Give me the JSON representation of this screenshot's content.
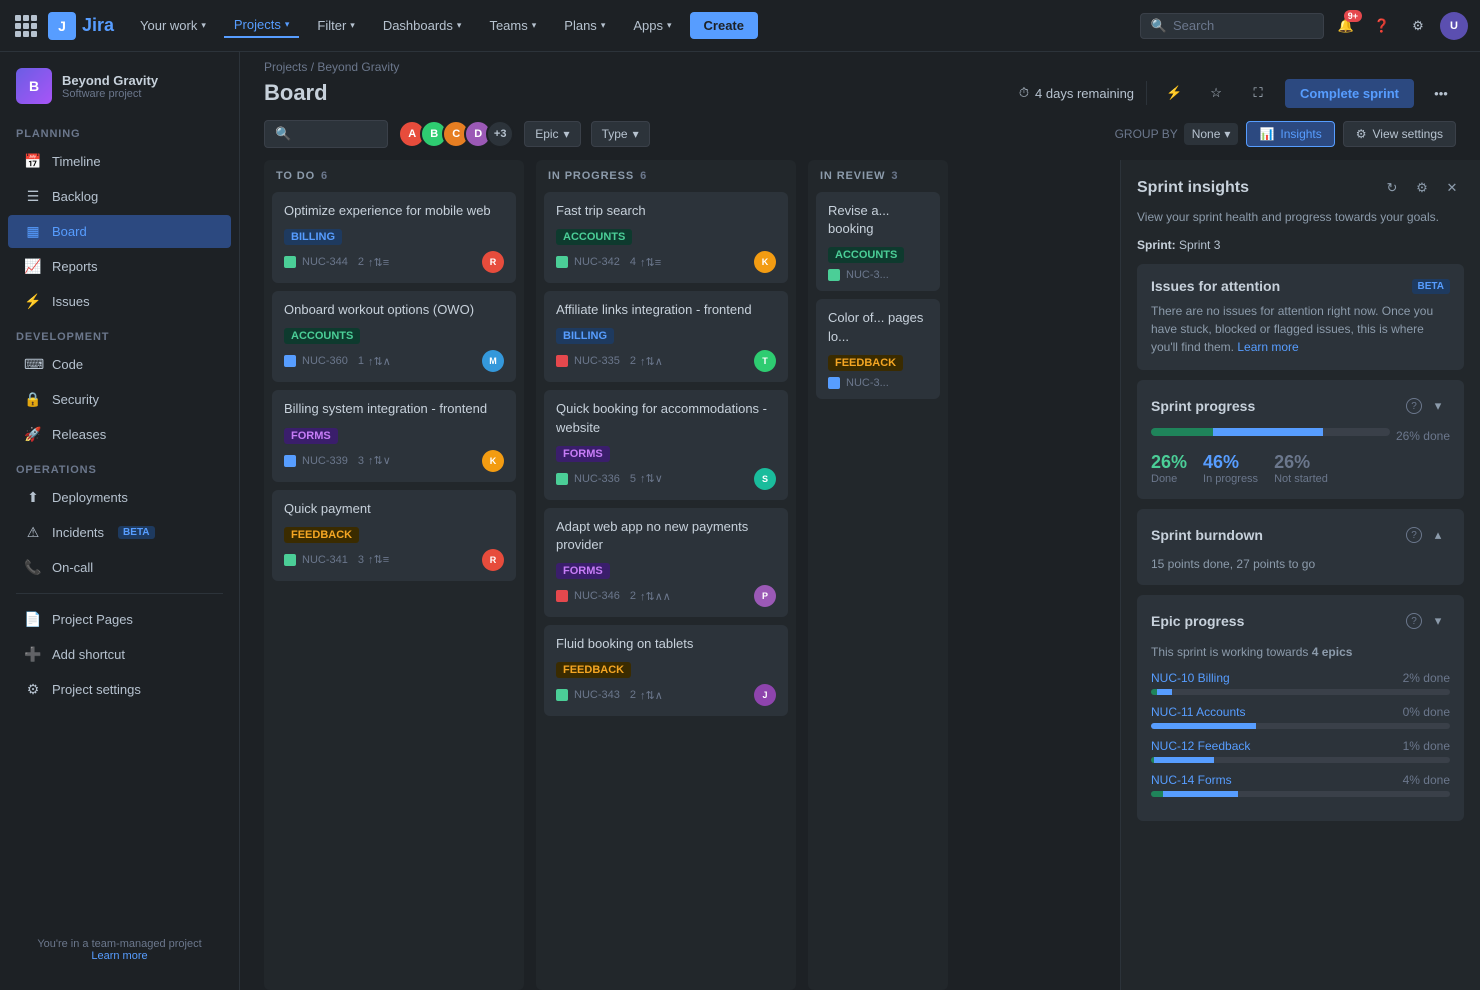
{
  "app": {
    "name": "Jira",
    "logo_text": "Jira"
  },
  "topnav": {
    "items": [
      {
        "id": "your-work",
        "label": "Your work",
        "chevron": true
      },
      {
        "id": "projects",
        "label": "Projects",
        "chevron": true,
        "active": true
      },
      {
        "id": "filter",
        "label": "Filter",
        "chevron": true
      },
      {
        "id": "dashboards",
        "label": "Dashboards",
        "chevron": true
      },
      {
        "id": "teams",
        "label": "Teams",
        "chevron": true
      },
      {
        "id": "plans",
        "label": "Plans",
        "chevron": true
      },
      {
        "id": "apps",
        "label": "Apps",
        "chevron": true
      }
    ],
    "create_label": "Create",
    "search_placeholder": "Search",
    "notif_count": "9+"
  },
  "sidebar": {
    "project_name": "Beyond Gravity",
    "project_type": "Software project",
    "project_icon_letter": "B",
    "sections": [
      {
        "label": "PLANNING",
        "items": [
          {
            "id": "timeline",
            "label": "Timeline",
            "icon": "📅"
          },
          {
            "id": "backlog",
            "label": "Backlog",
            "icon": "☰"
          },
          {
            "id": "board",
            "label": "Board",
            "icon": "▦",
            "active": true
          },
          {
            "id": "reports",
            "label": "Reports",
            "icon": "📈"
          },
          {
            "id": "issues",
            "label": "Issues",
            "icon": "⚡"
          }
        ]
      },
      {
        "label": "DEVELOPMENT",
        "items": [
          {
            "id": "code",
            "label": "Code",
            "icon": "⌨"
          },
          {
            "id": "security",
            "label": "Security",
            "icon": "🔒"
          },
          {
            "id": "releases",
            "label": "Releases",
            "icon": "🚀"
          }
        ]
      },
      {
        "label": "OPERATIONS",
        "items": [
          {
            "id": "deployments",
            "label": "Deployments",
            "icon": "⬆"
          },
          {
            "id": "incidents",
            "label": "Incidents",
            "icon": "⚠",
            "beta": true
          },
          {
            "id": "oncall",
            "label": "On-call",
            "icon": "📞"
          }
        ]
      }
    ],
    "footer_items": [
      {
        "id": "project-pages",
        "label": "Project Pages",
        "icon": "📄"
      },
      {
        "id": "add-shortcut",
        "label": "Add shortcut",
        "icon": "➕"
      },
      {
        "id": "project-settings",
        "label": "Project settings",
        "icon": "⚙"
      }
    ],
    "team_managed_text": "You're in a team-managed project",
    "learn_more": "Learn more"
  },
  "board": {
    "breadcrumb_project": "Projects",
    "breadcrumb_current": "Beyond Gravity",
    "title": "Board",
    "sprint_timer": "4 days remaining",
    "complete_sprint_label": "Complete sprint",
    "toolbar": {
      "epic_label": "Epic",
      "type_label": "Type",
      "group_by_label": "GROUP BY",
      "group_by_value": "None",
      "insights_label": "Insights",
      "view_settings_label": "View settings"
    },
    "avatars": [
      {
        "color": "#e74c3c",
        "letter": "A"
      },
      {
        "color": "#2ecc71",
        "letter": "B"
      },
      {
        "color": "#e67e22",
        "letter": "C"
      },
      {
        "color": "#9b59b6",
        "letter": "D"
      }
    ],
    "extra_avatars": "+3",
    "columns": [
      {
        "id": "todo",
        "label": "TO DO",
        "count": 6,
        "cards": [
          {
            "id": "card-1",
            "title": "Optimize experience for mobile web",
            "tag": "BILLING",
            "tag_type": "billing",
            "issue_id": "NUC-344",
            "issue_type": "story",
            "stats": "2",
            "priority": "medium",
            "avatar_color": "#e74c3c",
            "avatar_letter": "R"
          },
          {
            "id": "card-2",
            "title": "Onboard workout options (OWO)",
            "tag": "ACCOUNTS",
            "tag_type": "accounts",
            "issue_id": "NUC-360",
            "issue_type": "task",
            "stats": "1",
            "priority": "high",
            "avatar_color": "#3498db",
            "avatar_letter": "M"
          },
          {
            "id": "card-3",
            "title": "Billing system integration - frontend",
            "tag": "FORMS",
            "tag_type": "forms",
            "issue_id": "NUC-339",
            "issue_type": "task",
            "stats": "3",
            "priority": "low",
            "avatar_color": "#f39c12",
            "avatar_letter": "K"
          },
          {
            "id": "card-4",
            "title": "Quick payment",
            "tag": "FEEDBACK",
            "tag_type": "feedback",
            "issue_id": "NUC-341",
            "issue_type": "story",
            "stats": "3",
            "priority": "medium",
            "avatar_color": "#e74c3c",
            "avatar_letter": "R"
          }
        ]
      },
      {
        "id": "in-progress",
        "label": "IN PROGRESS",
        "count": 6,
        "cards": [
          {
            "id": "card-5",
            "title": "Fast trip search",
            "tag": "ACCOUNTS",
            "tag_type": "accounts",
            "issue_id": "NUC-342",
            "issue_type": "story",
            "stats": "4",
            "priority": "medium",
            "avatar_color": "#f39c12",
            "avatar_letter": "K"
          },
          {
            "id": "card-6",
            "title": "Affiliate links integration - frontend",
            "tag": "BILLING",
            "tag_type": "billing",
            "issue_id": "NUC-335",
            "issue_type": "bug",
            "stats": "2",
            "priority": "high",
            "avatar_color": "#2ecc71",
            "avatar_letter": "T"
          },
          {
            "id": "card-7",
            "title": "Quick booking for accommodations - website",
            "tag": "FORMS",
            "tag_type": "forms",
            "issue_id": "NUC-336",
            "issue_type": "story",
            "stats": "5",
            "priority": "low",
            "avatar_color": "#1abc9c",
            "avatar_letter": "S"
          },
          {
            "id": "card-8",
            "title": "Adapt web app no new payments provider",
            "tag": "FORMS",
            "tag_type": "forms",
            "issue_id": "NUC-346",
            "issue_type": "bug",
            "stats": "2",
            "priority": "high",
            "avatar_color": "#9b59b6",
            "avatar_letter": "P"
          },
          {
            "id": "card-9",
            "title": "Fluid booking on tablets",
            "tag": "FEEDBACK",
            "tag_type": "feedback",
            "issue_id": "NUC-343",
            "issue_type": "story",
            "stats": "2",
            "priority": "high",
            "avatar_color": "#8e44ad",
            "avatar_letter": "J"
          }
        ]
      }
    ],
    "in_review": {
      "label": "IN REVIEW",
      "count": 3,
      "cards": [
        {
          "title": "Revise a... booking",
          "tag": "ACCOUNTS",
          "tag_type": "accounts",
          "issue_id": "NUC-3...",
          "issue_type": "story"
        },
        {
          "title": "Color of... pages lo...",
          "tag": "FEEDBACK",
          "tag_type": "feedback",
          "issue_id": "NUC-3...",
          "issue_type": "task"
        }
      ]
    }
  },
  "sprint_insights": {
    "title": "Sprint insights",
    "desc": "View your sprint health and progress towards your goals.",
    "sprint_name": "Sprint 3",
    "issues_attention": {
      "title": "Issues for attention",
      "badge": "BETA",
      "text": "There are no issues for attention right now. Once you have stuck, blocked or flagged issues, this is where you'll find them.",
      "link_text": "Learn more"
    },
    "sprint_progress": {
      "title": "Sprint progress",
      "done_pct": 26,
      "in_progress_pct": 46,
      "not_started_pct": 26,
      "total_label": "26% done",
      "done_label": "Done",
      "done_value": "26%",
      "in_progress_label": "In progress",
      "in_progress_value": "46%",
      "not_started_label": "Not started",
      "not_started_value": "26%"
    },
    "sprint_burndown": {
      "title": "Sprint burndown",
      "text": "15 points done, 27 points to go"
    },
    "epic_progress": {
      "title": "Epic progress",
      "text": "This sprint is working towards",
      "bold_text": "4 epics",
      "epics": [
        {
          "id": "NUC-10",
          "name": "NUC-10 Billing",
          "pct_done_label": "2% done",
          "done_pct": 2,
          "inprog_pct": 5
        },
        {
          "id": "NUC-11",
          "name": "NUC-11 Accounts",
          "pct_done_label": "0% done",
          "done_pct": 0,
          "inprog_pct": 35
        },
        {
          "id": "NUC-12",
          "name": "NUC-12 Feedback",
          "pct_done_label": "1% done",
          "done_pct": 1,
          "inprog_pct": 20
        },
        {
          "id": "NUC-14",
          "name": "NUC-14 Forms",
          "pct_done_label": "4% done",
          "done_pct": 4,
          "inprog_pct": 25
        }
      ]
    }
  }
}
